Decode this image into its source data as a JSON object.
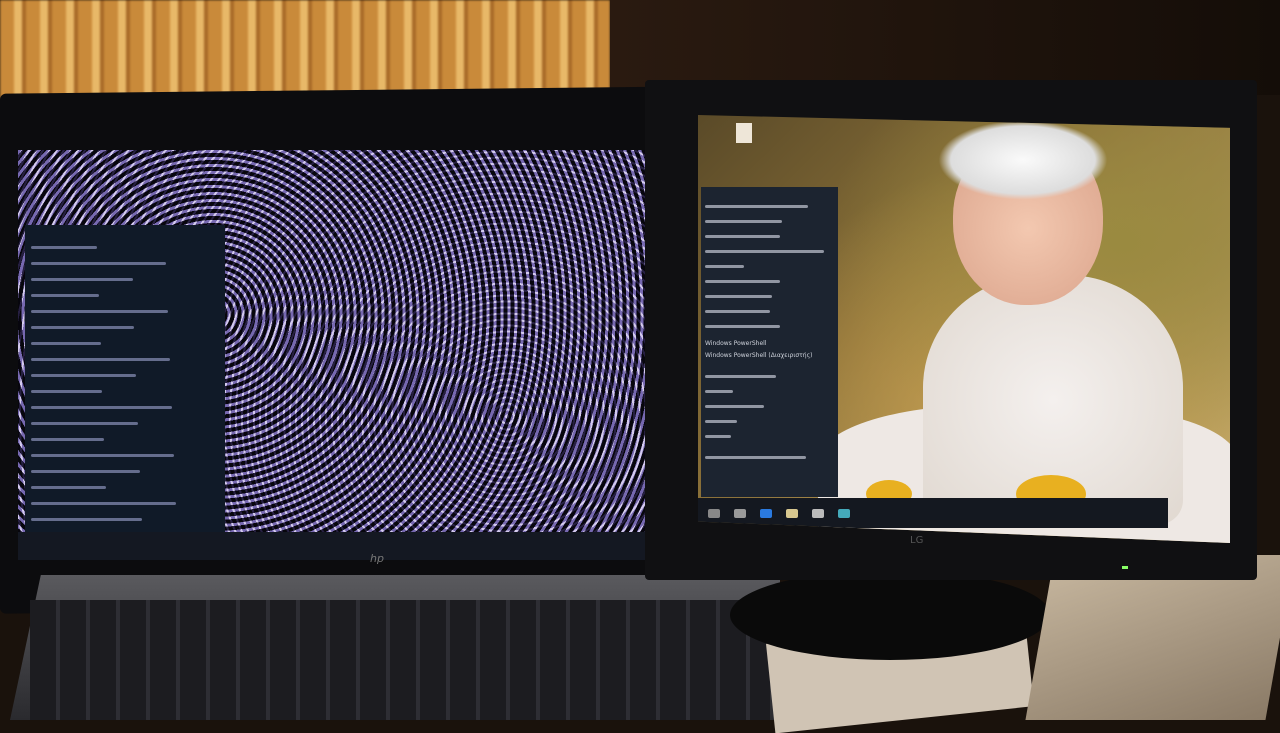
{
  "left_display": {
    "brand": "hp",
    "menu_lines": 18
  },
  "right_display": {
    "brand": "LG",
    "menu_items": [
      "Windows PowerShell",
      "Windows PowerShell (Διαχειριστής)"
    ],
    "menu_lines": 17
  },
  "colors": {
    "menu_bg": "#1c2430",
    "wallpaper_accent": "#e8b020"
  }
}
